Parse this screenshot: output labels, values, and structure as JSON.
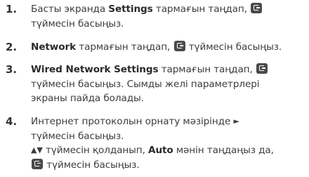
{
  "steps": [
    {
      "number": "1.",
      "setting": "Settings",
      "before": "Басты экранда ",
      "after": " тармағын таңдап, ",
      "line2": "түймесін басыңыз."
    },
    {
      "number": "2.",
      "setting": "Network",
      "after": " тармағын таңдап, ",
      "tail": " түймесін басыңыз."
    },
    {
      "number": "3.",
      "setting": "Wired Network Settings",
      "after": " тармағын таңдап, ",
      "line2": "түймесін басыңыз. Сымды желі параметрлері",
      "line3": "экраны пайда болады."
    },
    {
      "number": "4.",
      "line1": "Интернет протоколын орнату мәзірінде ",
      "right_arrow": "►",
      "line2": "түймесін басыңыз.",
      "updown": "▲▼",
      "line3_a": " түймесін қолданып, ",
      "option": "Auto",
      "line3_b": " мәнін таңдаңыз да,",
      "line4": " түймесін басыңыз."
    }
  ],
  "icons": {
    "enter": "enter-button-icon"
  }
}
